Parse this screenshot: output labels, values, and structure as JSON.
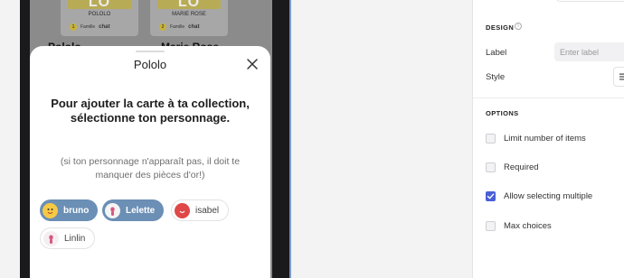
{
  "background": {
    "cards": [
      {
        "art_text": "LO",
        "name": "POLOLO",
        "number": "1",
        "family_prefix": "Famille",
        "family": "chat"
      },
      {
        "art_text": "LO",
        "name": "MARIE ROSE",
        "number": "2",
        "family_prefix": "Famille",
        "family": "chat"
      }
    ],
    "under_labels": [
      "Pololo",
      "Marie Rose"
    ]
  },
  "sheet": {
    "title": "Pololo",
    "prompt_line1": "Pour ajouter la carte à ta collection,",
    "prompt_line2": "sélectionne ton personnage.",
    "hint_line1": "(si ton personnage n'apparaît pas, il doit te",
    "hint_line2": "manquer des pièces d'or!)",
    "characters": [
      {
        "label": "bruno",
        "selected": true,
        "avatar": "bruno-avatar-icon",
        "color": "#f6c945"
      },
      {
        "label": "Lelette",
        "selected": true,
        "avatar": "lelette-avatar-icon",
        "color": "#f4f4f4"
      },
      {
        "label": "isabel",
        "selected": false,
        "avatar": "isabel-avatar-icon",
        "color": "#e04848"
      },
      {
        "label": "Linlin",
        "selected": false,
        "avatar": "linlin-avatar-icon",
        "color": "#f4eef2"
      }
    ]
  },
  "panel": {
    "design_heading": "DESIGN",
    "label_field_label": "Label",
    "label_placeholder": "Enter label",
    "style_label": "Style",
    "options_heading": "OPTIONS",
    "options": [
      {
        "label": "Limit number of items",
        "checked": false
      },
      {
        "label": "Required",
        "checked": false
      },
      {
        "label": "Allow selecting multiple",
        "checked": true
      },
      {
        "label": "Max choices",
        "checked": false
      }
    ]
  },
  "colors": {
    "selected_chip": "#6b8fb5",
    "checkbox_accent": "#4a5fd6"
  }
}
